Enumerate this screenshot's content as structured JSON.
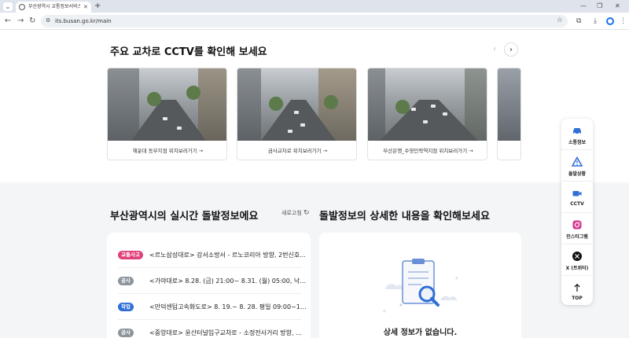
{
  "browser": {
    "tab_title": "부산광역시 교통정보서비스센터",
    "url": "its.busan.go.kr/main",
    "new_tab": "+",
    "minimize": "—",
    "maximize": "❐",
    "close": "✕"
  },
  "cctv": {
    "title": "주요 교차로 CCTV를 확인해 보세요",
    "prev_icon": "chevron-left-icon",
    "next_icon": "chevron-right-icon",
    "cards": [
      {
        "caption": "해운대 동부지점 위치보러가기 →"
      },
      {
        "caption": "금사교차로 위치보러가기 →"
      },
      {
        "caption": "부산은행_수영민락역지점 위치보러가기 →"
      }
    ]
  },
  "incidents": {
    "title": "부산광역시의 실시간 돌발정보에요",
    "refresh_label": "새로고침",
    "items": [
      {
        "badge": "교통사고",
        "badge_color": "#e0407a",
        "text": "<르노삼성대로> 강서소방서 - 르노코리아 방향, 2번신호..."
      },
      {
        "badge": "공사",
        "badge_color": "#8c949c",
        "text": "<가야대로> 8.28. (금) 21:00~ 8.31. (월) 05:00, 낙동대..."
      },
      {
        "badge": "작업",
        "badge_color": "#2f6fd6",
        "text": "<만덕센텀고속화도로> 8. 19.~ 8. 28. 평일 09:00~16:00..."
      },
      {
        "badge": "공사",
        "badge_color": "#8c949c",
        "text": "<중앙대로> 윤산터널입구교차로 - 소정전사거리 방향, 부곡..."
      }
    ]
  },
  "detail": {
    "title": "돌발정보의 상세한 내용을 확인해보세요",
    "empty_message": "상세 정보가 없습니다."
  },
  "sidemenu": {
    "items": [
      {
        "label": "소통정보",
        "icon": "car-icon"
      },
      {
        "label": "돌발상황",
        "icon": "warning-icon"
      },
      {
        "label": "CCTV",
        "icon": "camera-icon"
      },
      {
        "label": "인스타그램",
        "icon": "instagram-icon"
      },
      {
        "label": "X (트위터)",
        "icon": "x-logo-icon"
      },
      {
        "label": "TOP",
        "icon": "arrow-up-icon"
      }
    ]
  },
  "colors": {
    "accent": "#2f6fd6",
    "background_lower": "#f4f5f7"
  }
}
